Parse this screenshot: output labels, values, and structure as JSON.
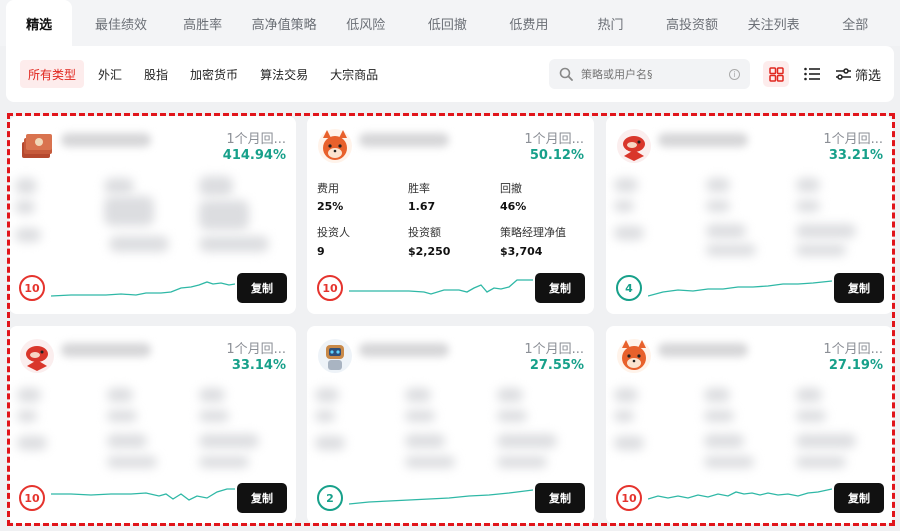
{
  "tabs": [
    "精选",
    "最佳绩效",
    "高胜率",
    "高净值策略",
    "低风险",
    "低回撤",
    "低费用",
    "热门",
    "高投资额",
    "关注列表",
    "全部"
  ],
  "types": [
    "所有类型",
    "外汇",
    "股指",
    "加密货币",
    "算法交易",
    "大宗商品"
  ],
  "search": {
    "placeholder": "策略或用户名§"
  },
  "filter_label": "筛选",
  "colors": {
    "accent_red": "#e0261e",
    "roi_teal": "#17a08a",
    "highlight": "#e1151b"
  },
  "cards": [
    {
      "avatar": "money-stack-icon",
      "period": "1个月回...",
      "roi": "414.94%",
      "badge": "10",
      "copy": "复制"
    },
    {
      "avatar": "shiba-dog-icon",
      "period": "1个月回...",
      "roi": "50.12%",
      "badge": "10",
      "copy": "复制",
      "metrics": [
        {
          "label": "费用",
          "value": "25%"
        },
        {
          "label": "胜率",
          "value": "1.67"
        },
        {
          "label": "回撤",
          "value": "46%"
        },
        {
          "label": "投资人",
          "value": "9"
        },
        {
          "label": "投资额",
          "value": "$2,250"
        },
        {
          "label": "策略经理净值",
          "value": "$3,704"
        }
      ]
    },
    {
      "avatar": "koi-fish-icon",
      "period": "1个月回...",
      "roi": "33.21%",
      "badge": "4",
      "copy": "复制"
    },
    {
      "avatar": "koi-fish-icon",
      "period": "1个月回...",
      "roi": "33.14%",
      "badge": "10",
      "copy": "复制"
    },
    {
      "avatar": "robot-icon",
      "period": "1个月回...",
      "roi": "27.55%",
      "badge": "2",
      "copy": "复制"
    },
    {
      "avatar": "shiba-dog-icon",
      "period": "1个月回...",
      "roi": "27.19%",
      "badge": "10",
      "copy": "复制"
    }
  ]
}
